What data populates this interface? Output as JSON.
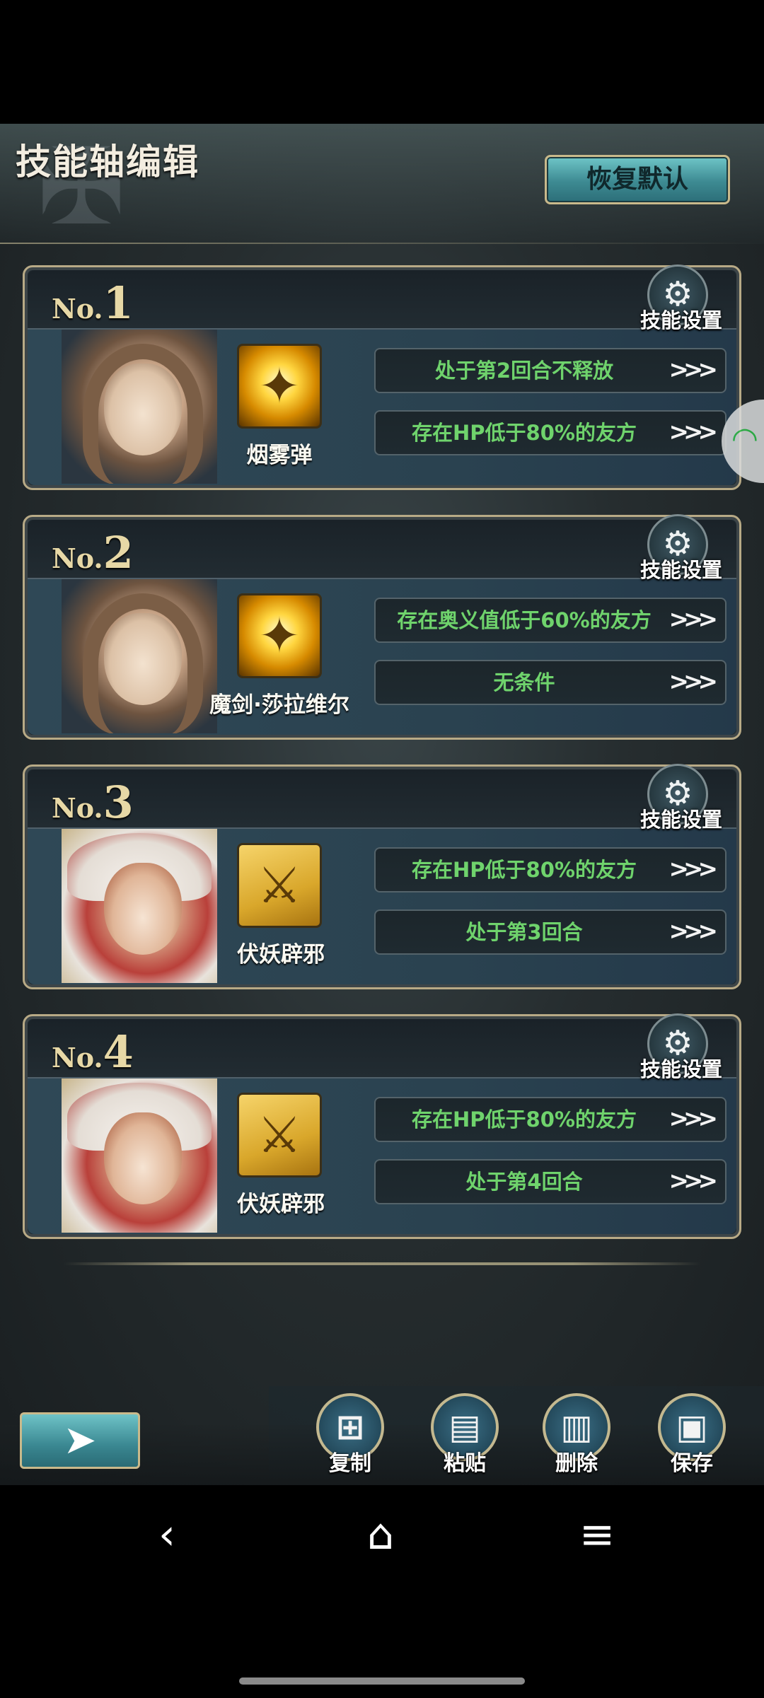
{
  "header": {
    "title": "技能轴编辑",
    "reset_label": "恢复默认"
  },
  "cards": [
    {
      "no_prefix": "No.",
      "no_num": "1",
      "settings_label": "技能设置",
      "portrait": "brown-haired-girl",
      "skill_name": "烟雾弹",
      "conditions": [
        "处于第2回合不释放",
        "存在HP低于80%的友方"
      ]
    },
    {
      "no_prefix": "No.",
      "no_num": "2",
      "settings_label": "技能设置",
      "portrait": "brown-haired-girl",
      "skill_name": "魔剑·莎拉维尔",
      "conditions": [
        "存在奥义值低于60%的友方",
        "无条件"
      ]
    },
    {
      "no_prefix": "No.",
      "no_num": "3",
      "settings_label": "技能设置",
      "portrait": "red-hood-girl",
      "skill_name": "伏妖辟邪",
      "conditions": [
        "存在HP低于80%的友方",
        "处于第3回合"
      ]
    },
    {
      "no_prefix": "No.",
      "no_num": "4",
      "settings_label": "技能设置",
      "portrait": "red-hood-girl",
      "skill_name": "伏妖辟邪",
      "conditions": [
        "存在HP低于80%的友方",
        "处于第4回合"
      ]
    }
  ],
  "icons": {
    "settings": "gear-icon",
    "chevron": "triple-chevron-right-icon",
    "back": "back-arrow-icon",
    "copy": "copy-icon",
    "paste": "paste-icon",
    "delete": "trash-icon",
    "save": "floppy-disk-icon"
  },
  "toolbar": {
    "copy_label": "复制",
    "paste_label": "粘贴",
    "delete_label": "删除",
    "save_label": "保存"
  },
  "colors": {
    "condition_text": "#6fd36c",
    "accent_teal": "#3d8a92",
    "frame_gold": "#b8aa86"
  }
}
